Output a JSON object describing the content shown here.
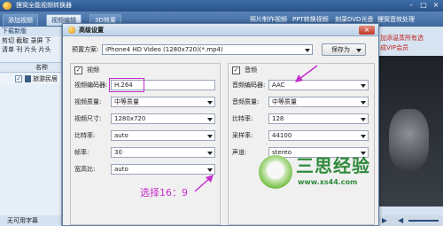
{
  "app": {
    "title": "狸窝全能视频转换器",
    "tabs": [
      "添加视频",
      "视频编辑",
      "3D效果"
    ],
    "active_tab_index": 1,
    "top_links": [
      "照片制作视频",
      "PPT转换视频",
      "刻录DVD光盘",
      "狸窝音效处理"
    ],
    "left_panel": {
      "header": "下载新版",
      "tools_row1": "剪切 截取 录屏 下",
      "tools_row2": "清单 刊 片头 片头",
      "list_header": "名称",
      "list_item_name": "旅游民居",
      "bottom_label": "无可用字幕"
    },
    "right_panel": {
      "promo_line1": "加添温蒸所有选",
      "promo_line2": "成VIP会员"
    }
  },
  "dialog": {
    "title": "高级设置",
    "preset": {
      "label": "预置方案:",
      "value": "iPhone4 HD Video (1280x720)(*.mp4)"
    },
    "save_as": "保存为",
    "video": {
      "title": "视频",
      "enabled": true,
      "fields": [
        {
          "label": "视频编码器:",
          "value": "H.264"
        },
        {
          "label": "视频质量:",
          "value": "中等质量"
        },
        {
          "label": "视频尺寸:",
          "value": "1280x720"
        },
        {
          "label": "比特率:",
          "value": "auto"
        },
        {
          "label": "帧率:",
          "value": "30"
        },
        {
          "label": "宽高比:",
          "value": "auto"
        }
      ]
    },
    "audio": {
      "title": "音频",
      "enabled": true,
      "fields": [
        {
          "label": "音频编码器:",
          "value": "AAC"
        },
        {
          "label": "音频质量:",
          "value": "中等质量"
        },
        {
          "label": "比特率:",
          "value": "128"
        },
        {
          "label": "采样率:",
          "value": "44100"
        },
        {
          "label": "声道:",
          "value": "stereo"
        }
      ]
    }
  },
  "annotation": "选择16：9",
  "watermark": {
    "text": "三思经验",
    "url": "www.xs44.com"
  },
  "colors": {
    "accent": "#c52fd0",
    "titlebar": "#2a5288"
  }
}
